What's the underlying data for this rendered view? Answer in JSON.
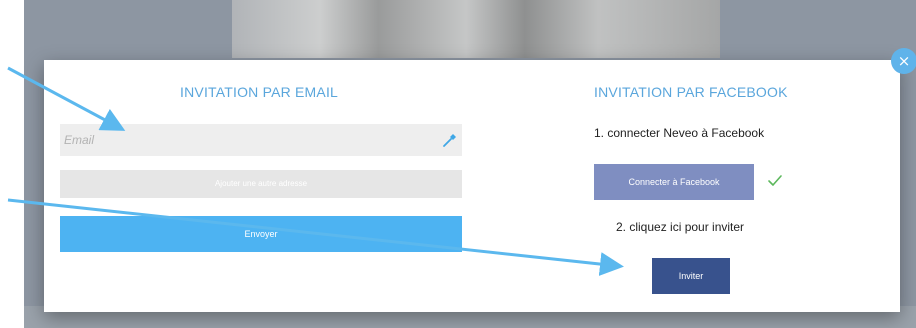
{
  "modal": {
    "close_glyph": "×",
    "email_section": {
      "heading": "INVITATION PAR EMAIL",
      "email_placeholder": "Email",
      "email_value": "",
      "add_address_label": "Ajouter une autre adresse",
      "send_label": "Envoyer"
    },
    "facebook_section": {
      "heading": "INVITATION PAR FACEBOOK",
      "step1": "1. connecter Neveo à Facebook",
      "connect_label": "Connecter à Facebook",
      "connected_status_icon": "check-icon",
      "step2": "2. cliquez ici pour inviter",
      "invite_label": "Inviter"
    }
  },
  "colors": {
    "heading": "#5aa6dc",
    "send_button": "#4db3f2",
    "connect_button": "#7f8ec1",
    "invite_button": "#38528d",
    "check": "#5cb85c",
    "annotation_arrow": "#5bb8ee"
  },
  "icons": {
    "field_icon": "eyedropper-icon",
    "close": "close-icon"
  }
}
